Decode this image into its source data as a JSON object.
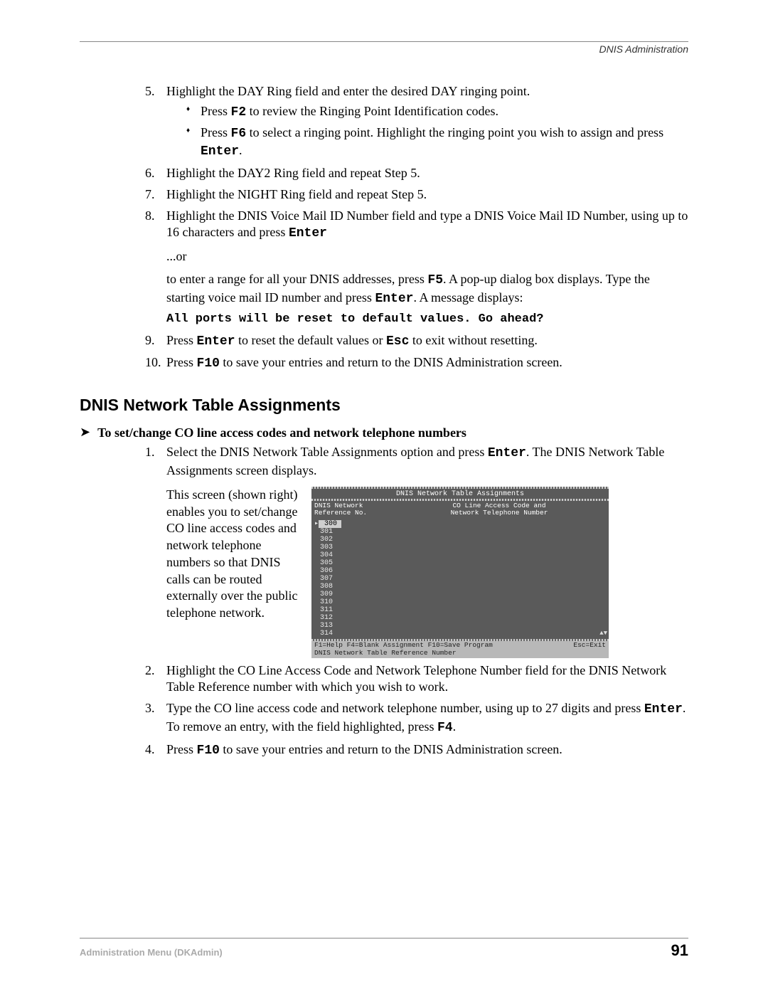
{
  "header": {
    "section": "DNIS Administration"
  },
  "steps_a": {
    "s5": {
      "num": "5.",
      "text": "Highlight the DAY Ring field and enter the desired DAY ringing point.",
      "b1a": "Press ",
      "b1key": "F2",
      "b1b": " to review the Ringing Point Identification codes.",
      "b2a": "Press ",
      "b2key": "F6",
      "b2b": " to select a ringing point. Highlight the ringing point you wish to assign and press ",
      "b2key2": "Enter",
      "b2c": "."
    },
    "s6": {
      "num": "6.",
      "text": "Highlight the DAY2 Ring field and repeat Step 5."
    },
    "s7": {
      "num": "7.",
      "text": "Highlight the NIGHT Ring field and repeat Step 5."
    },
    "s8": {
      "num": "8.",
      "a": "Highlight the DNIS Voice Mail ID Number field and type a DNIS Voice Mail ID Number, using up to 16 characters and press ",
      "key": "Enter",
      "or": "...or",
      "b1": "to enter a range for all your DNIS addresses, press ",
      "bkey": "F5",
      "b2": ". A pop-up dialog box displays. Type the starting voice mail ID number and press ",
      "bkey2": "Enter",
      "b3": ". A message displays:",
      "code": "All ports will be reset to default values. Go ahead?"
    },
    "s9": {
      "num": "9.",
      "a": "Press ",
      "k1": "Enter",
      "b": " to reset the default values or ",
      "k2": "Esc",
      "c": " to exit without resetting."
    },
    "s10": {
      "num": "10.",
      "a": "Press ",
      "k1": "F10",
      "b": " to save your entries and return to the DNIS Administration screen."
    }
  },
  "section_heading": "DNIS Network Table Assignments",
  "subheading": "To set/change CO line access codes and network telephone numbers",
  "steps_b": {
    "s1": {
      "num": "1.",
      "a": "Select the DNIS Network Table Assignments option and press ",
      "k": "Enter",
      "b": ". The DNIS Network Table Assignments screen displays."
    },
    "para": "This screen (shown right) enables you to set/change CO line access codes and network telephone numbers so that DNIS calls can be routed externally over the public telephone network.",
    "s2": {
      "num": "2.",
      "a": "Highlight the CO Line Access Code and Network Telephone Number field for the DNIS Network Table Reference number with which you wish to work."
    },
    "s3": {
      "num": "3.",
      "a": "Type the CO line access code and network telephone number, using up to 27 digits and press ",
      "k1": "Enter",
      "b": ". To remove an entry, with the field highlighted, press ",
      "k2": "F4",
      "c": "."
    },
    "s4": {
      "num": "4.",
      "a": "Press ",
      "k1": "F10",
      "b": " to save your entries and return to the DNIS Administration screen."
    }
  },
  "terminal": {
    "title": "DNIS Network Table Assignments",
    "col1a": "DNIS Network",
    "col1b": "Reference No.",
    "col2a": "CO Line Access Code and",
    "col2b": "Network Telephone Number",
    "rows": [
      "300",
      "301",
      "302",
      "303",
      "304",
      "305",
      "306",
      "307",
      "308",
      "309",
      "310",
      "311",
      "312",
      "313",
      "314"
    ],
    "scroll": "▲▼",
    "footer1_left": "F1=Help  F4=Blank Assignment  F10=Save Program",
    "footer1_right": "Esc=Exit",
    "footer2": "DNIS Network Table Reference Number"
  },
  "footer": {
    "left": "Administration Menu (DKAdmin)",
    "page": "91"
  }
}
